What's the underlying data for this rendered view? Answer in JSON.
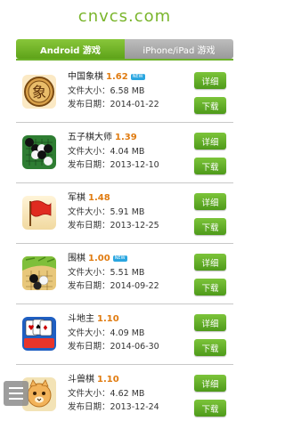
{
  "site": {
    "title": "cnvcs.com"
  },
  "tabs": [
    {
      "label": "Android 游戏",
      "active": true
    },
    {
      "label": "iPhone/iPad 游戏",
      "active": false
    }
  ],
  "labels": {
    "size_prefix": "文件大小：",
    "date_prefix": "发布日期：",
    "details_button": "详细",
    "download_button": "下载",
    "new_badge": "NEW"
  },
  "apps": [
    {
      "name": "中国象棋",
      "version": "1.62",
      "is_new": true,
      "size": "6.58 MB",
      "date": "2014-01-22",
      "icon": "xiangqi-chess-icon"
    },
    {
      "name": "五子棋大师",
      "version": "1.39",
      "is_new": false,
      "size": "4.04 MB",
      "date": "2013-12-10",
      "icon": "gomoku-board-icon"
    },
    {
      "name": "军棋",
      "version": "1.48",
      "is_new": false,
      "size": "5.91 MB",
      "date": "2013-12-25",
      "icon": "red-flag-icon"
    },
    {
      "name": "围棋",
      "version": "1.00",
      "is_new": true,
      "size": "5.51 MB",
      "date": "2014-09-22",
      "icon": "go-stones-icon"
    },
    {
      "name": "斗地主",
      "version": "1.10",
      "is_new": false,
      "size": "4.09 MB",
      "date": "2014-06-30",
      "icon": "playing-cards-icon"
    },
    {
      "name": "斗兽棋",
      "version": "1.10",
      "is_new": false,
      "size": "4.62 MB",
      "date": "2013-12-24",
      "icon": "animal-chess-icon"
    }
  ],
  "colors": {
    "accent_green": "#6db22a",
    "version_orange": "#e07b10",
    "badge_blue": "#2aa6e0"
  }
}
